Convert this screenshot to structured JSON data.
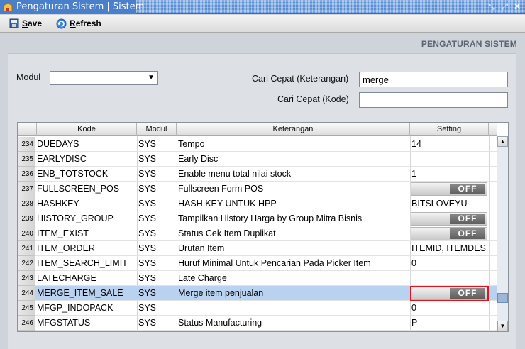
{
  "window": {
    "title": "Pengaturan Sistem | Sistem",
    "buttons": [
      "restore",
      "maximize",
      "close"
    ]
  },
  "toolbar": {
    "save_label": "Save",
    "refresh_label": "Refresh"
  },
  "section_title": "PENGATURAN SISTEM",
  "filters": {
    "modul_label": "Modul",
    "modul_value": "",
    "cari_ket_label": "Cari Cepat (Keterangan)",
    "cari_ket_value": "merge",
    "cari_kode_label": "Cari Cepat (Kode)",
    "cari_kode_value": ""
  },
  "grid": {
    "headers": [
      "Kode",
      "Modul",
      "Keterangan",
      "Setting"
    ],
    "rows": [
      {
        "num": "234",
        "kode": "DUEDAYS",
        "modul": "SYS",
        "ket": "Tempo",
        "set": "14",
        "toggle": false,
        "selected": false
      },
      {
        "num": "235",
        "kode": "EARLYDISC",
        "modul": "SYS",
        "ket": "Early Disc",
        "set": "",
        "toggle": false,
        "selected": false
      },
      {
        "num": "236",
        "kode": "ENB_TOTSTOCK",
        "modul": "SYS",
        "ket": "Enable menu total nilai stock",
        "set": "1",
        "toggle": false,
        "selected": false
      },
      {
        "num": "237",
        "kode": "FULLSCREEN_POS",
        "modul": "SYS",
        "ket": "Fullscreen Form POS",
        "set": "OFF",
        "toggle": true,
        "selected": false
      },
      {
        "num": "238",
        "kode": "HASHKEY",
        "modul": "SYS",
        "ket": "HASH KEY UNTUK HPP",
        "set": "BITSLOVEYU",
        "toggle": false,
        "selected": false
      },
      {
        "num": "239",
        "kode": "HISTORY_GROUP",
        "modul": "SYS",
        "ket": "Tampilkan History Harga by Group Mitra Bisnis",
        "set": "OFF",
        "toggle": true,
        "selected": false
      },
      {
        "num": "240",
        "kode": "ITEM_EXIST",
        "modul": "SYS",
        "ket": "Status Cek Item Duplikat",
        "set": "OFF",
        "toggle": true,
        "selected": false
      },
      {
        "num": "241",
        "kode": "ITEM_ORDER",
        "modul": "SYS",
        "ket": "Urutan Item",
        "set": "ITEMID, ITEMDES",
        "toggle": false,
        "selected": false
      },
      {
        "num": "242",
        "kode": "ITEM_SEARCH_LIMIT",
        "modul": "SYS",
        "ket": "Huruf Minimal Untuk Pencarian Pada Picker Item",
        "set": "0",
        "toggle": false,
        "selected": false
      },
      {
        "num": "243",
        "kode": "LATECHARGE",
        "modul": "SYS",
        "ket": "Late Charge",
        "set": "",
        "toggle": false,
        "selected": false
      },
      {
        "num": "244",
        "kode": "MERGE_ITEM_SALE",
        "modul": "SYS",
        "ket": "Merge item penjualan",
        "set": "OFF",
        "toggle": true,
        "selected": true
      },
      {
        "num": "245",
        "kode": "MFGP_INDOPACK",
        "modul": "SYS",
        "ket": "",
        "set": "0",
        "toggle": false,
        "selected": false
      },
      {
        "num": "246",
        "kode": "MFGSTATUS",
        "modul": "SYS",
        "ket": "Status Manufacturing",
        "set": "P",
        "toggle": false,
        "selected": false
      }
    ]
  },
  "scrollbar": {
    "position_fraction": 0.89
  }
}
